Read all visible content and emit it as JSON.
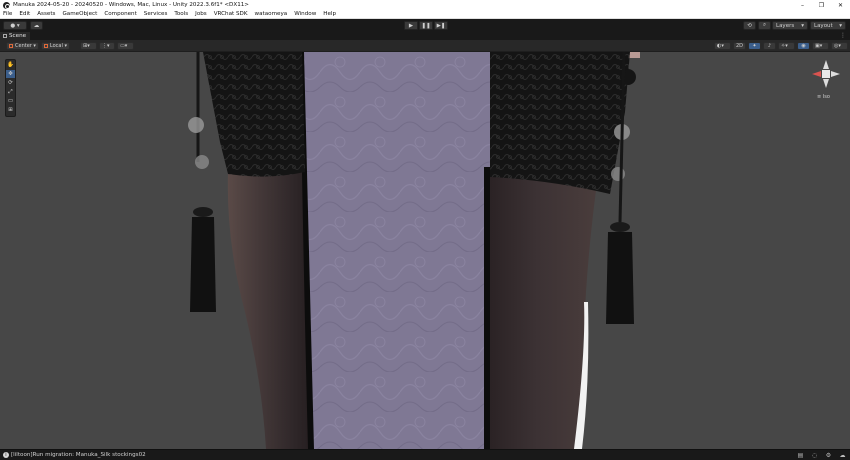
{
  "window": {
    "title": "Manuka 2024-05-20 - 20240520 - Windows, Mac, Linux - Unity 2022.3.6f1* <DX11>",
    "controls": [
      "–",
      "❐",
      "✕"
    ]
  },
  "menu": [
    "File",
    "Edit",
    "Assets",
    "GameObject",
    "Component",
    "Services",
    "Tools",
    "Jobs",
    "VRChat SDK",
    "wataomeya",
    "Window",
    "Help"
  ],
  "toolbar": {
    "account_label": "",
    "layers_label": "Layers",
    "layout_label": "Layout",
    "play": "▶",
    "pause": "❚❚",
    "step": "▶❚"
  },
  "scene_tab": {
    "label": "Scene",
    "menu": "⋮"
  },
  "scene_toolbar": {
    "pivot_label": "Center",
    "space_label": "Local",
    "mode_2d": "2D"
  },
  "tools": [
    "✋",
    "✥",
    "⟳",
    "⤢",
    "▭",
    "⊞"
  ],
  "gizmo": {
    "persp_label": "≡ Iso"
  },
  "status": {
    "message": "[liltoon]Run migration: Manuka_Silk stockings02"
  },
  "colors": {
    "accent": "#3b5e8b",
    "viewport_bg": "#474747",
    "panel_fabric": "#7e7791",
    "stocking": "#3a3234"
  }
}
